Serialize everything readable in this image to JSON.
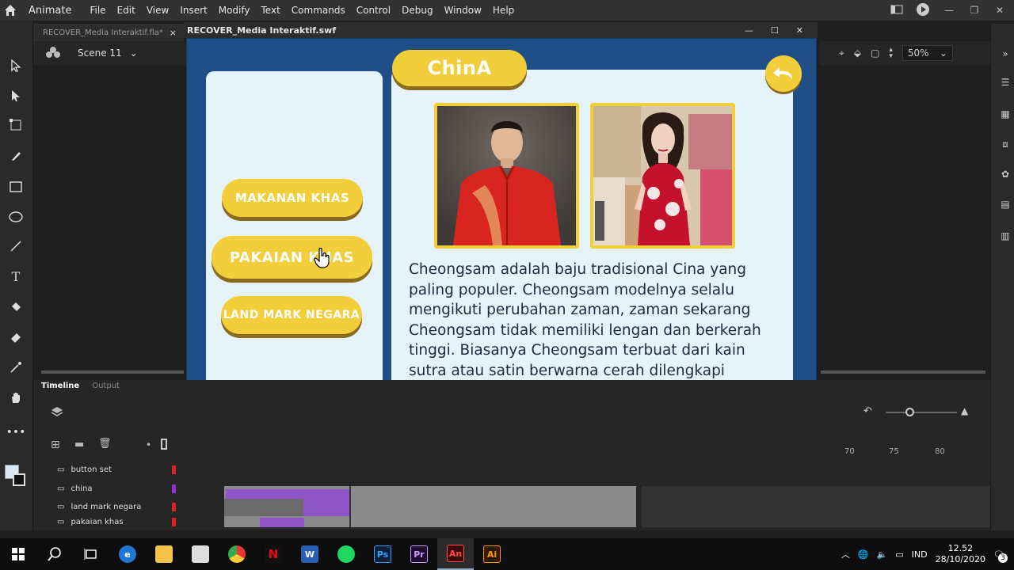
{
  "menubar": {
    "app_name": "Animate",
    "items": [
      "File",
      "Edit",
      "View",
      "Insert",
      "Modify",
      "Text",
      "Commands",
      "Control",
      "Debug",
      "Window",
      "Help"
    ]
  },
  "doc_tab": {
    "name": "RECOVER_Media Interaktif.fla*",
    "close": "×"
  },
  "scene": {
    "name": "Scene 11"
  },
  "zoom": {
    "value": "50%"
  },
  "swf_window": {
    "title": "RECOVER_Media Interaktif.swf"
  },
  "app": {
    "title": "ChinA",
    "buttons": {
      "makanan": "MAKANAN KHAS",
      "pakaian": "PAKAIAN KHAS",
      "landmark": "LAND MARK NEGARA"
    },
    "description": "Cheongsam adalah baju tradisional Cina yang paling populer. Cheongsam modelnya selalu mengikuti perubahan zaman, zaman sekarang Cheongsam tidak memiliki lengan dan berkerah tinggi. Biasanya Cheongsam terbuat dari kain sutra atau satin berwarna cerah dilengkapi dengan bordiran khas Cina. Cheongsam untuk kalangan laki-laki disebut dengan Changshan."
  },
  "timeline": {
    "tabs": [
      "Timeline",
      "Output"
    ],
    "layers": [
      "button set",
      "china",
      "land mark negara",
      "pakaian khas"
    ],
    "frame_numbers": [
      "70",
      "75",
      "80"
    ]
  },
  "taskbar": {
    "lang": "IND",
    "time": "12.52",
    "date": "28/10/2020",
    "notif_count": "3"
  },
  "colors": {
    "accent": "#f2cf3a",
    "stage_bg": "#1f4e86",
    "card_bg": "#e6f3fb"
  }
}
